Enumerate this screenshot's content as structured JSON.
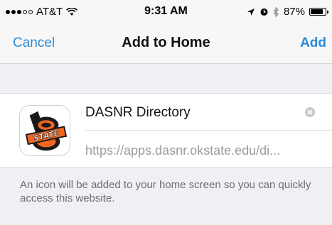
{
  "status_bar": {
    "carrier": "AT&T",
    "time": "9:31 AM",
    "battery_percent": "87%",
    "battery_level": 0.87,
    "signal_bars_filled": 3,
    "signal_bars_total": 5,
    "icons": [
      "signal-dots-icon",
      "wifi-icon",
      "location-arrow-icon",
      "alarm-icon",
      "bluetooth-icon",
      "battery-icon"
    ]
  },
  "nav": {
    "cancel_label": "Cancel",
    "title": "Add to Home",
    "add_label": "Add"
  },
  "bookmark": {
    "name": "DASNR Directory",
    "url": "https://apps.dasnr.okstate.edu/di...",
    "icon": "osu-state-logo-icon"
  },
  "hint_text": "An icon will be added to your home screen so you can quickly access this website.",
  "colors": {
    "accent": "#2b8cd8",
    "background": "#efeff4",
    "logo_orange": "#f26522",
    "logo_black": "#000000"
  }
}
